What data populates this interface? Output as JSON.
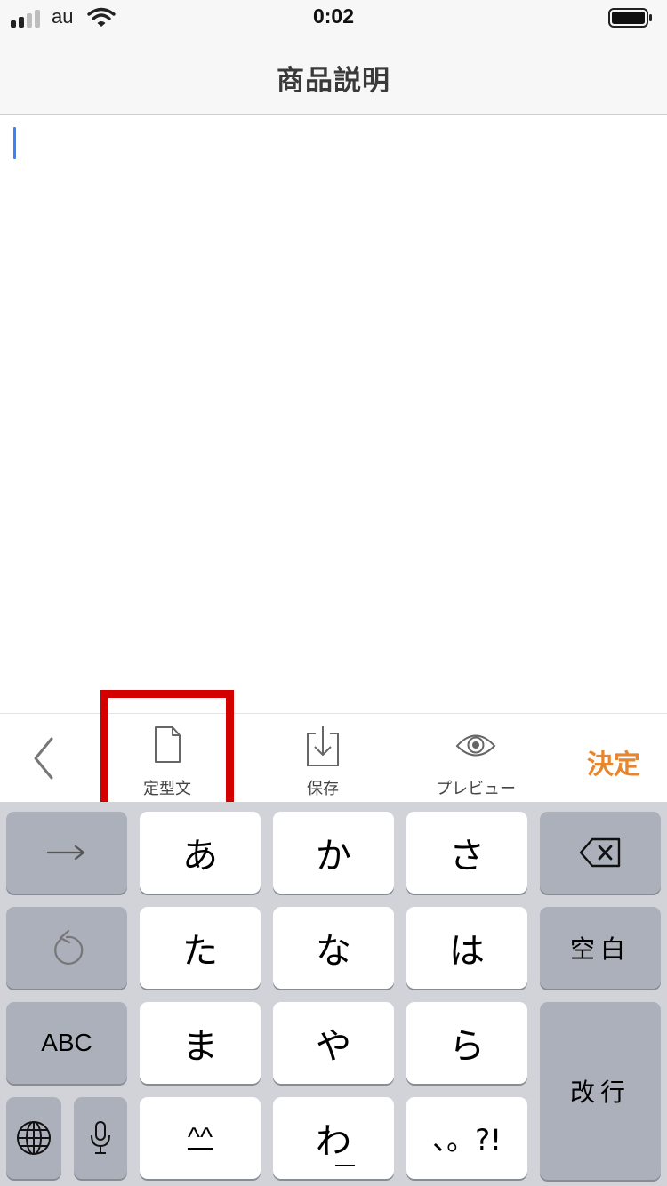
{
  "status_bar": {
    "carrier": "au",
    "time": "0:02"
  },
  "nav": {
    "title": "商品説明"
  },
  "editor": {
    "text": ""
  },
  "toolbar": {
    "template_label": "定型文",
    "save_label": "保存",
    "preview_label": "プレビュー",
    "done_label": "決定",
    "done_color": "#e8862e",
    "highlight_color": "#d40000"
  },
  "keyboard": {
    "keys": {
      "a": "あ",
      "ka": "か",
      "sa": "さ",
      "ta": "た",
      "na": "な",
      "ha": "は",
      "ma": "ま",
      "ya": "や",
      "ra": "ら",
      "kao": "^^",
      "wa": "わ",
      "punct": "、。?!",
      "abc": "ABC",
      "space": "空白",
      "enter": "改行"
    },
    "icons": {
      "next": "arrow-right-icon",
      "undo": "undo-icon",
      "globe": "globe-icon",
      "mic": "microphone-icon",
      "delete": "delete-backspace-icon"
    }
  }
}
